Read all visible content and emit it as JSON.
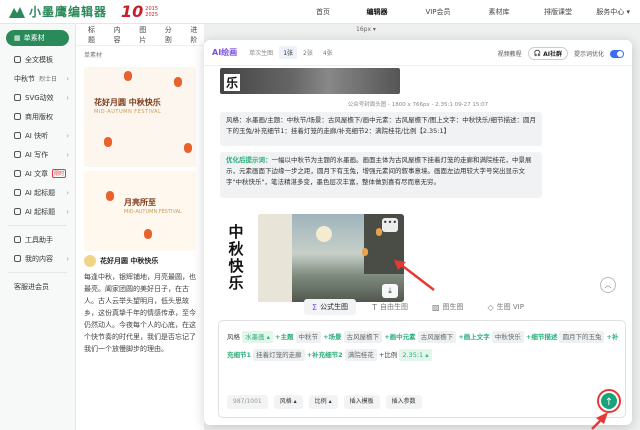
{
  "topbar": {
    "brand": "小墨鹰编辑器",
    "anniv_number": "10",
    "anniv_years": [
      "2015",
      "2025"
    ],
    "nav": [
      "首页",
      "编辑器",
      "VIP会员",
      "素材库",
      "排版课堂"
    ],
    "nav_active_index": 1,
    "right_label": "服务中心 ▾"
  },
  "left_sidebar": {
    "primary_button": "单素材",
    "items": [
      {
        "label": "全文模板",
        "icon": "template-icon"
      },
      {
        "label": "中秋节",
        "extra": "烈士日",
        "icon": "calendar-icon"
      },
      {
        "label": "SVG动效",
        "icon": "svg-icon"
      },
      {
        "label": "商用版权",
        "icon": "copyright-icon"
      },
      {
        "label": "AI 快听",
        "icon": "ai-icon"
      },
      {
        "label": "AI 写作",
        "icon": "pen-icon"
      },
      {
        "label": "AI 文章",
        "icon": "article-icon",
        "badge": "限时"
      },
      {
        "label": "AI 起标题",
        "icon": "title-icon"
      },
      {
        "label": "AI 起标题",
        "icon": "title-icon"
      },
      {
        "label": "工具助手",
        "icon": "tool-icon"
      },
      {
        "label": "我的内容",
        "icon": "folder-icon"
      }
    ],
    "footer": "客服进会员"
  },
  "middle_panel": {
    "tabs": [
      "标题",
      "内容",
      "图片",
      "分割",
      "进阶"
    ],
    "section_title": "单素材",
    "card1": {
      "title": "花好月圆 中秋快乐",
      "subtitle": "MID-AUTUMN FESTIVAL"
    },
    "card2": {
      "title": "月亮所至",
      "subtitle": "MID-AUTUMN FESTIVAL"
    },
    "article_title": "花好月圆 中秋快乐",
    "article_text": "每逢中秋，银辉铺地，月亮最圆，也最亮。阖家团圆的美好日子，在古人。古人云举头望明月，低头思故乡，这份真挚千年的情感传承，至今仍然动人。今夜每个人的心底，在这个快节奏的时代里，我们是否忘记了我们一个放慢脚步的理由。"
  },
  "editor_toolbar": "16px ▾",
  "modal": {
    "title": "AI绘画",
    "count_label": "单次生图",
    "count_options": [
      "1张",
      "2张",
      "4张"
    ],
    "count_selected": 0,
    "right": {
      "tutorial": "视频教程",
      "ai_group": "AI社群",
      "optimize_label": "提示词优化",
      "optimize_on": true
    },
    "image_caption": "公众号封面头图 - 1800 x 766px - 2.35:1   09-27 15:07",
    "top_image_char": "乐",
    "prompt_text": "风格：水墨画/主题：中秋节/场景：古风屋檐下/画中元素：古风屋檐下/图上文字：中秋快乐/细节描述：圆月下的玉兔/补充细节1：挂着灯笼的走廊/补充细节2：满院桂花/比例【2.35:1】",
    "optimized_label": "优化后提示词：",
    "optimized_text": "一幅以中秋节为主题的水墨画。画面主体为古风屋檐下挂着灯笼的走廊和满院桂花，中景展示，元素画面下边缘一步之距，圆月下有玉兔，增强元素间的叙事意境。画面左边用较大字号突出显示文字\"中秋快乐\"，笔法精湛多变，墨色层次丰富，整体做到喜有尽而意无穷。",
    "calligraphy": [
      "中",
      "秋",
      "快",
      "乐"
    ],
    "more_button": "•••",
    "download_icon": "⤓",
    "tabs": [
      {
        "label": "公式生图",
        "icon": "sigma-icon",
        "glyph": "Σ",
        "selected": true
      },
      {
        "label": "自由生图",
        "icon": "text-icon",
        "glyph": "T",
        "selected": false
      },
      {
        "label": "图生图",
        "icon": "image-icon",
        "glyph": "▨",
        "selected": false
      },
      {
        "label": "生图 VIP",
        "icon": "diamond-icon",
        "glyph": "◇",
        "selected": false
      }
    ],
    "formula": [
      {
        "key": "风格",
        "value": "水墨画 ▴",
        "green": true,
        "plain_key": true
      },
      {
        "key": "+主题",
        "value": "中秋节"
      },
      {
        "key": "+场景",
        "value": "古风屋檐下"
      },
      {
        "key": "+画中元素",
        "value": "古风屋檐下"
      },
      {
        "key": "+画上文字",
        "value": "中秋快乐"
      },
      {
        "key": "+细节描述",
        "value": "圆月下的玉兔"
      },
      {
        "key": "+补充细节1",
        "value": "挂着灯笼的走廊"
      },
      {
        "key": "+补充细节2",
        "value": "满院桂花"
      },
      {
        "key": "+比例",
        "value": "2.35:1 ▴",
        "green": true,
        "plain_key": true
      }
    ],
    "bottom": {
      "count": "987/1001",
      "style_btn": "风格 ▴",
      "ratio_btn": "比例 ▴",
      "insert_template": "插入模板",
      "insert_param": "插入参数",
      "send_icon": "↑"
    },
    "scroll_icon": "︿"
  }
}
